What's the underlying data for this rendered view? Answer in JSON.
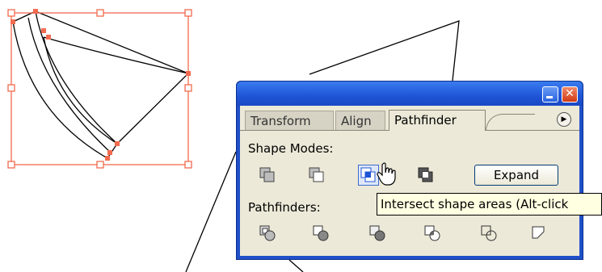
{
  "panel": {
    "tabs": [
      {
        "label": "Transform"
      },
      {
        "label": "Align"
      },
      {
        "label": "Pathfinder"
      }
    ],
    "menu_icon": "panel-menu-triangle-icon",
    "shape_modes_label": "Shape Modes:",
    "shape_mode_buttons": [
      {
        "icon": "add-to-shape-area-icon"
      },
      {
        "icon": "subtract-from-shape-area-icon"
      },
      {
        "icon": "intersect-shape-areas-icon",
        "pressed": true
      },
      {
        "icon": "exclude-overlapping-shape-areas-icon"
      }
    ],
    "expand_label": "Expand",
    "pathfinders_label": "Pathfinders:",
    "pathfinder_buttons": [
      {
        "icon": "divide-icon"
      },
      {
        "icon": "trim-icon"
      },
      {
        "icon": "merge-icon"
      },
      {
        "icon": "crop-icon"
      },
      {
        "icon": "outline-icon"
      },
      {
        "icon": "minus-back-icon"
      }
    ]
  },
  "tooltip": {
    "text": "Intersect shape areas (Alt-click"
  },
  "colors": {
    "selection": "#f26b4f",
    "title_bar": "#1f55d6",
    "panel_bg": "#ece9d8",
    "tooltip_bg": "#ffffe1"
  }
}
